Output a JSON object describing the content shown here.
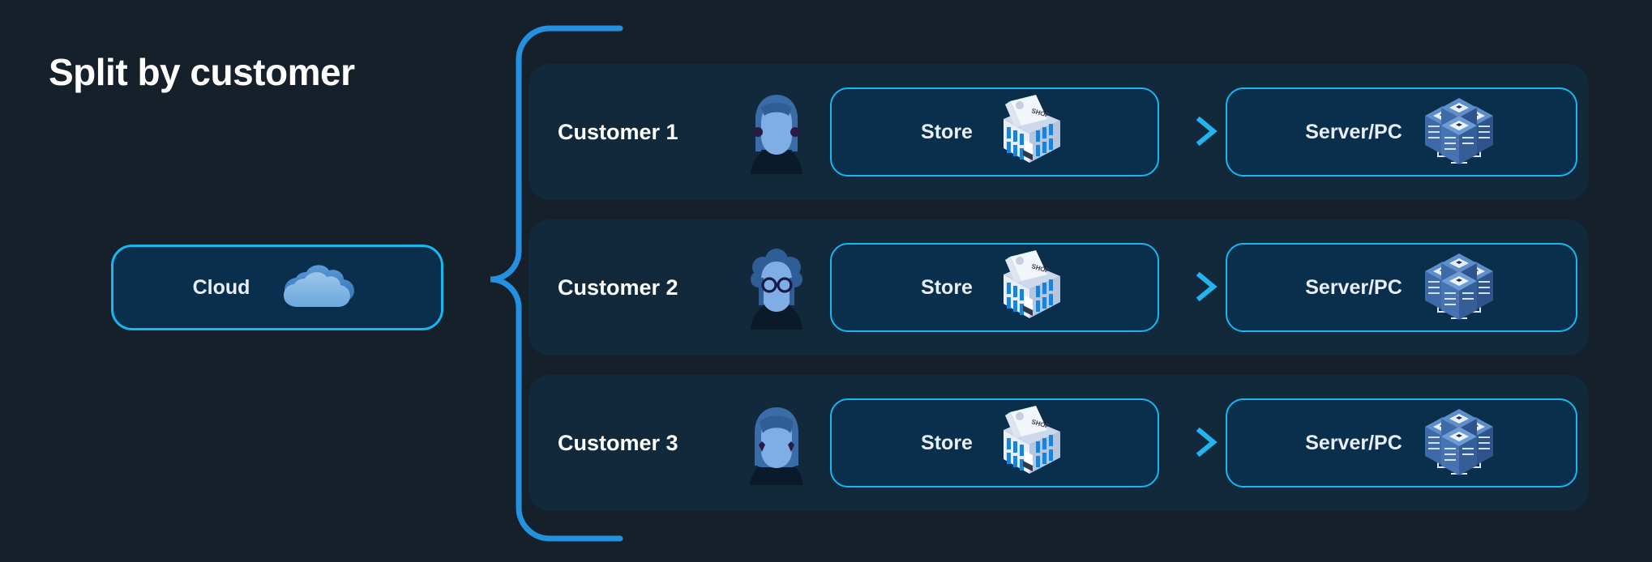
{
  "page": {
    "title": "Split by customer",
    "background_color": "#15202b",
    "accent_color": "#17b8f0",
    "node_fill_color": "#0a2f4d",
    "row_fill_color": "#12293c"
  },
  "cloud_node": {
    "label": "Cloud",
    "icon": "cloud-icon"
  },
  "connector": {
    "name": "brace-connector",
    "icon": "brace-icon"
  },
  "rows": [
    {
      "customer_label": "Customer 1",
      "avatar": "avatar-long-hair-bangs-icon",
      "store": {
        "label": "Store",
        "icon": "shop-building-icon"
      },
      "arrow": "arrow-right-icon",
      "server": {
        "label": "Server/PC",
        "icon": "server-rack-icon"
      }
    },
    {
      "customer_label": "Customer 2",
      "avatar": "avatar-curly-hair-glasses-icon",
      "store": {
        "label": "Store",
        "icon": "shop-building-icon"
      },
      "arrow": "arrow-right-icon",
      "server": {
        "label": "Server/PC",
        "icon": "server-rack-icon"
      }
    },
    {
      "customer_label": "Customer 3",
      "avatar": "avatar-shoulder-hair-earrings-icon",
      "store": {
        "label": "Store",
        "icon": "shop-building-icon"
      },
      "arrow": "arrow-right-icon",
      "server": {
        "label": "Server/PC",
        "icon": "server-rack-icon"
      }
    }
  ]
}
